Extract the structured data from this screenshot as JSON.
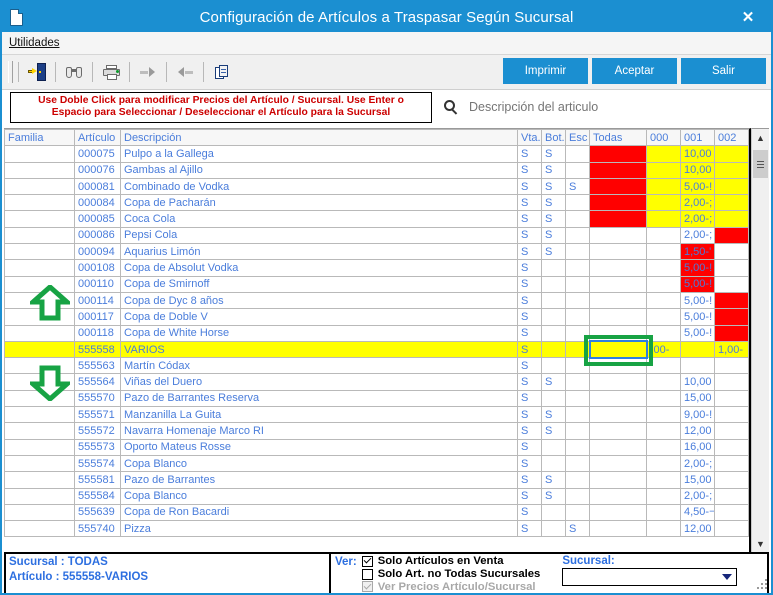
{
  "window": {
    "title": "Configuración de Artículos a Traspasar Según Sucursal",
    "close_label": "✕",
    "icon": "window-document-icon"
  },
  "menubar": {
    "items": [
      {
        "label": "Utilidades"
      }
    ]
  },
  "toolbar": {
    "icons": [
      {
        "name": "exit-door-icon",
        "label": "Salir"
      },
      {
        "name": "binoculars-search-icon",
        "label": "Buscar"
      },
      {
        "name": "printer-icon",
        "label": "Imprimir"
      },
      {
        "name": "arrow-forward-icon",
        "label": "Siguiente"
      },
      {
        "name": "arrow-back-icon",
        "label": "Anterior"
      },
      {
        "name": "copy-documents-icon",
        "label": "Copiar"
      }
    ],
    "print_label": "Imprimir",
    "accept_label": "Aceptar",
    "exit_label": "Salir",
    "accent_color": "#1b8fd1"
  },
  "notice": {
    "line1": "Use Doble Click para modificar Precios del Artículo / Sucursal. Use Enter o",
    "line2": "Espacio para Seleccionar / Deseleccionar el Artículo para la Sucursal",
    "color": "#cc0000"
  },
  "search": {
    "icon": "search-icon",
    "placeholder": "Descripción del articulo",
    "value": ""
  },
  "grid": {
    "columns": [
      {
        "key": "familia",
        "label": "Familia"
      },
      {
        "key": "articulo",
        "label": "Artículo"
      },
      {
        "key": "descripcion",
        "label": "Descripción"
      },
      {
        "key": "vta",
        "label": "Vta."
      },
      {
        "key": "bot",
        "label": "Bot."
      },
      {
        "key": "esc",
        "label": "Esc"
      },
      {
        "key": "todas",
        "label": "Todas"
      },
      {
        "key": "s000",
        "label": "000"
      },
      {
        "key": "s001",
        "label": "001"
      },
      {
        "key": "s002",
        "label": "002"
      }
    ],
    "rows": [
      {
        "familia": "",
        "articulo": "000075",
        "descripcion": "Pulpo a la Gallega",
        "vta": "S",
        "bot": "S",
        "esc": "",
        "todas": "",
        "todas_state": "red",
        "s000": "",
        "s000_state": "yel",
        "s001": "10,00",
        "s001_state": "yel",
        "s002": "",
        "s002_state": "yel"
      },
      {
        "familia": "",
        "articulo": "000076",
        "descripcion": "Gambas al Ajillo",
        "vta": "S",
        "bot": "S",
        "esc": "",
        "todas": "",
        "todas_state": "red",
        "s000": "",
        "s000_state": "yel",
        "s001": "10,00",
        "s001_state": "yel",
        "s002": "",
        "s002_state": "yel"
      },
      {
        "familia": "",
        "articulo": "000081",
        "descripcion": "Combinado de Vodka",
        "vta": "S",
        "bot": "S",
        "esc": "S",
        "todas": "",
        "todas_state": "red",
        "s000": "",
        "s000_state": "yel",
        "s001": "5,00-!",
        "s001_state": "yel",
        "s002": "",
        "s002_state": "yel"
      },
      {
        "familia": "",
        "articulo": "000084",
        "descripcion": "Copa de Pacharán",
        "vta": "S",
        "bot": "S",
        "esc": "",
        "todas": "",
        "todas_state": "red",
        "s000": "",
        "s000_state": "yel",
        "s001": "2,00-;",
        "s001_state": "yel",
        "s002": "",
        "s002_state": "yel"
      },
      {
        "familia": "",
        "articulo": "000085",
        "descripcion": "Coca Cola",
        "vta": "S",
        "bot": "S",
        "esc": "",
        "todas": "",
        "todas_state": "red",
        "s000": "",
        "s000_state": "yel",
        "s001": "2,00-;",
        "s001_state": "yel",
        "s002": "",
        "s002_state": "yel"
      },
      {
        "familia": "",
        "articulo": "000086",
        "descripcion": "Pepsi Cola",
        "vta": "S",
        "bot": "S",
        "esc": "",
        "todas": "",
        "todas_state": "white",
        "s000": "",
        "s000_state": "white",
        "s001": "2,00-;",
        "s001_state": "white",
        "s002": "",
        "s002_state": "red"
      },
      {
        "familia": "",
        "articulo": "000094",
        "descripcion": "Aquarius Limón",
        "vta": "S",
        "bot": "S",
        "esc": "",
        "todas": "",
        "todas_state": "white",
        "s000": "",
        "s000_state": "white",
        "s001": "1,50-'",
        "s001_state": "redtxt",
        "s002": "",
        "s002_state": "white"
      },
      {
        "familia": "",
        "articulo": "000108",
        "descripcion": "Copa de Absolut Vodka",
        "vta": "S",
        "bot": "",
        "esc": "",
        "todas": "",
        "todas_state": "white",
        "s000": "",
        "s000_state": "white",
        "s001": "5,00-!",
        "s001_state": "redtxt",
        "s002": "",
        "s002_state": "white"
      },
      {
        "familia": "",
        "articulo": "000110",
        "descripcion": "Copa de Smirnoff",
        "vta": "S",
        "bot": "",
        "esc": "",
        "todas": "",
        "todas_state": "white",
        "s000": "",
        "s000_state": "white",
        "s001": "5,00-!",
        "s001_state": "redtxt",
        "s002": "",
        "s002_state": "white"
      },
      {
        "familia": "",
        "articulo": "000114",
        "descripcion": "Copa de Dyc 8 años",
        "vta": "S",
        "bot": "",
        "esc": "",
        "todas": "",
        "todas_state": "white",
        "s000": "",
        "s000_state": "white",
        "s001": "5,00-!",
        "s001_state": "white",
        "s002": "",
        "s002_state": "red"
      },
      {
        "familia": "",
        "articulo": "000117",
        "descripcion": "Copa de Doble V",
        "vta": "S",
        "bot": "",
        "esc": "",
        "todas": "",
        "todas_state": "white",
        "s000": "",
        "s000_state": "white",
        "s001": "5,00-!",
        "s001_state": "white",
        "s002": "",
        "s002_state": "red"
      },
      {
        "familia": "",
        "articulo": "000118",
        "descripcion": "Copa de White Horse",
        "vta": "S",
        "bot": "",
        "esc": "",
        "todas": "",
        "todas_state": "white",
        "s000": "",
        "s000_state": "white",
        "s001": "5,00-!",
        "s001_state": "white",
        "s002": "",
        "s002_state": "red"
      },
      {
        "familia": "",
        "articulo": "555558",
        "descripcion": "VARIOS",
        "vta": "S",
        "bot": "",
        "esc": "",
        "todas": "",
        "todas_state": "selected",
        "s000": ",00-",
        "s000_state": "sel",
        "s001": "",
        "s001_state": "sel",
        "s002": "1,00-",
        "s002_state": "sel",
        "selected": true
      },
      {
        "familia": "",
        "articulo": "555563",
        "descripcion": "Martín Códax",
        "vta": "S",
        "bot": "",
        "esc": "",
        "todas": "",
        "todas_state": "white",
        "s000": "",
        "s000_state": "white",
        "s001": "",
        "s001_state": "white",
        "s002": "",
        "s002_state": "white"
      },
      {
        "familia": "",
        "articulo": "555564",
        "descripcion": "Viñas del Duero",
        "vta": "S",
        "bot": "S",
        "esc": "",
        "todas": "",
        "todas_state": "white",
        "s000": "",
        "s000_state": "white",
        "s001": "10,00",
        "s001_state": "white",
        "s002": "",
        "s002_state": "white"
      },
      {
        "familia": "",
        "articulo": "555570",
        "descripcion": "Pazo de Barrantes Reserva",
        "vta": "S",
        "bot": "",
        "esc": "",
        "todas": "",
        "todas_state": "white",
        "s000": "",
        "s000_state": "white",
        "s001": "15,00",
        "s001_state": "white",
        "s002": "",
        "s002_state": "white"
      },
      {
        "familia": "",
        "articulo": "555571",
        "descripcion": "Manzanilla La Guita",
        "vta": "S",
        "bot": "S",
        "esc": "",
        "todas": "",
        "todas_state": "white",
        "s000": "",
        "s000_state": "white",
        "s001": "9,00-!",
        "s001_state": "white",
        "s002": "",
        "s002_state": "white"
      },
      {
        "familia": "",
        "articulo": "555572",
        "descripcion": "Navarra Homenaje Marco RI",
        "vta": "S",
        "bot": "S",
        "esc": "",
        "todas": "",
        "todas_state": "white",
        "s000": "",
        "s000_state": "white",
        "s001": "12,00",
        "s001_state": "white",
        "s002": "",
        "s002_state": "white"
      },
      {
        "familia": "",
        "articulo": "555573",
        "descripcion": "Oporto Mateus Rosse",
        "vta": "S",
        "bot": "",
        "esc": "",
        "todas": "",
        "todas_state": "white",
        "s000": "",
        "s000_state": "white",
        "s001": "16,00",
        "s001_state": "white",
        "s002": "",
        "s002_state": "white"
      },
      {
        "familia": "",
        "articulo": "555574",
        "descripcion": "Copa Blanco",
        "vta": "S",
        "bot": "",
        "esc": "",
        "todas": "",
        "todas_state": "white",
        "s000": "",
        "s000_state": "white",
        "s001": "2,00-;",
        "s001_state": "white",
        "s002": "",
        "s002_state": "white"
      },
      {
        "familia": "",
        "articulo": "555581",
        "descripcion": "Pazo de Barrantes",
        "vta": "S",
        "bot": "S",
        "esc": "",
        "todas": "",
        "todas_state": "white",
        "s000": "",
        "s000_state": "white",
        "s001": "15,00",
        "s001_state": "white",
        "s002": "",
        "s002_state": "white"
      },
      {
        "familia": "",
        "articulo": "555584",
        "descripcion": "Copa Blanco",
        "vta": "S",
        "bot": "S",
        "esc": "",
        "todas": "",
        "todas_state": "white",
        "s000": "",
        "s000_state": "white",
        "s001": "2,00-;",
        "s001_state": "white",
        "s002": "",
        "s002_state": "white"
      },
      {
        "familia": "",
        "articulo": "555639",
        "descripcion": "Copa de Ron Bacardi",
        "vta": "S",
        "bot": "",
        "esc": "",
        "todas": "",
        "todas_state": "white",
        "s000": "",
        "s000_state": "white",
        "s001": "4,50-¬",
        "s001_state": "white",
        "s002": "",
        "s002_state": "white"
      },
      {
        "familia": "",
        "articulo": "555740",
        "descripcion": "Pizza",
        "vta": "S",
        "bot": "",
        "esc": "S",
        "todas": "",
        "todas_state": "white",
        "s000": "",
        "s000_state": "white",
        "s001": "12,00",
        "s001_state": "white",
        "s002": "",
        "s002_state": "white"
      }
    ],
    "nav_up_icon": "arrow-up-icon",
    "nav_down_icon": "arrow-down-icon",
    "annotation_color": "#17a344"
  },
  "scrollbar": {
    "up_icon": "chevron-up-icon",
    "down_icon": "chevron-down-icon"
  },
  "status": {
    "sucursal_label": "Sucursal : TODAS",
    "articulo_label": "Artículo : 555558-VARIOS"
  },
  "filters": {
    "ver_label": "Ver:",
    "options": [
      {
        "label": "Solo Artículos en Venta",
        "checked": true,
        "disabled": false
      },
      {
        "label": "Solo Art. no Todas Sucursales",
        "checked": false,
        "disabled": false
      },
      {
        "label": "Ver Precios Artículo/Sucursal",
        "checked": true,
        "disabled": true
      }
    ]
  },
  "sucursal": {
    "label": "Sucursal:",
    "value": "",
    "caret_icon": "chevron-down-icon"
  }
}
